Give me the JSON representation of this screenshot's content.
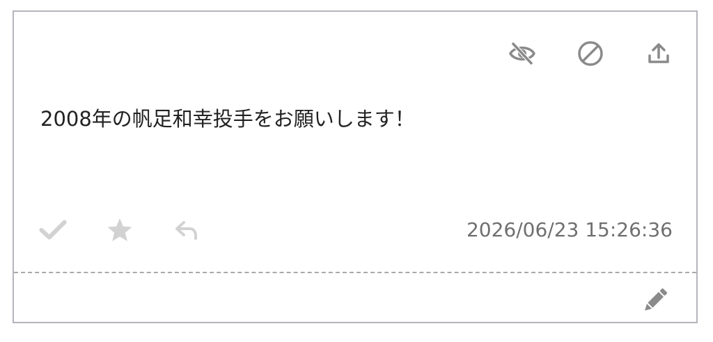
{
  "card": {
    "message": "2008年の帆足和幸投手をお願いします！",
    "timestamp": "2026/06/23 15:26:36"
  },
  "top_actions": {
    "icons": [
      "eye-slash-icon",
      "ban-icon",
      "upload-icon"
    ]
  },
  "bottom_actions": {
    "icons": [
      "check-icon",
      "star-icon",
      "reply-icon"
    ]
  },
  "footer": {
    "icons": [
      "pencil-icon"
    ]
  },
  "colors": {
    "border": "#b4b4bc",
    "icon_dark": "#8a8a8a",
    "icon_light": "#d2d2d2",
    "text": "#222222",
    "timestamp": "#6f6f6f",
    "divider": "#a9a9a9"
  }
}
